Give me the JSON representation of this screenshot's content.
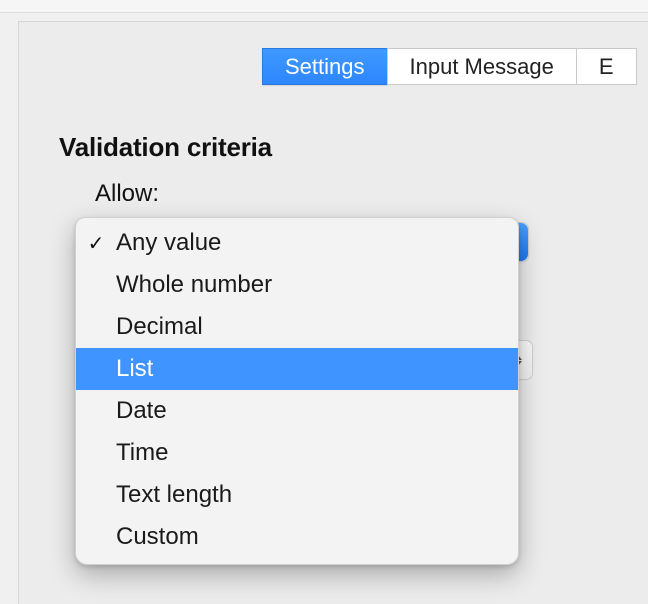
{
  "tabs": {
    "settings": "Settings",
    "input_message": "Input Message",
    "error_alert_partial": "E"
  },
  "section": {
    "title": "Validation criteria",
    "allow_label": "Allow:"
  },
  "allow_dropdown": {
    "selected": "Any value",
    "highlighted": "List",
    "options": [
      "Any value",
      "Whole number",
      "Decimal",
      "List",
      "Date",
      "Time",
      "Text length",
      "Custom"
    ]
  }
}
